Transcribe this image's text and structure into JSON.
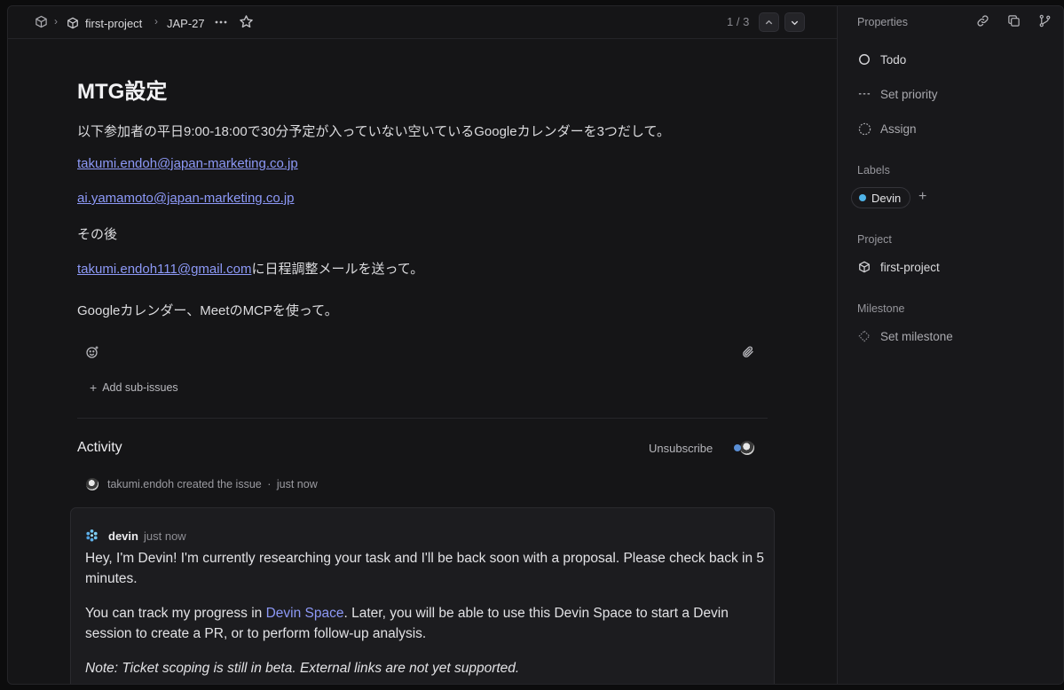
{
  "header": {
    "breadcrumbs": [
      "first-project",
      "JAP-27"
    ],
    "pager": "1 / 3"
  },
  "issue": {
    "title": "MTG設定",
    "paragraph1": "以下参加者の平日9:00-18:00で30分予定が入っていない空いているGoogleカレンダーを3つだして。",
    "email1": "takumi.endoh@japan-marketing.co.jp",
    "email2": "ai.yamamoto@japan-marketing.co.jp",
    "then": "その後",
    "email3": "takumi.endoh111@gmail.com",
    "email3_suffix": "に日程調整メールを送って。",
    "paragraph_last": "Googleカレンダー、MeetのMCPを使って。",
    "add_sub_issues": "Add sub-issues"
  },
  "activity": {
    "heading": "Activity",
    "unsubscribe": "Unsubscribe",
    "created_text": "takumi.endoh created the issue",
    "created_sep": "·",
    "created_time": "just now",
    "comment": {
      "author": "devin",
      "time": "just now",
      "line1": "Hey, I'm Devin! I'm currently researching your task and I'll be back soon with a proposal. Please check back in 5 minutes.",
      "line2_before": "You can track my progress in ",
      "line2_link": "Devin Space",
      "line2_after": ". Later, you will be able to use this Devin Space to start a Devin session to create a PR, or to perform follow-up analysis.",
      "line3": "Note: Ticket scoping is still in beta. External links are not yet supported."
    }
  },
  "sidebar": {
    "heading": "Properties",
    "status": "Todo",
    "priority": "Set priority",
    "assign": "Assign",
    "labels_heading": "Labels",
    "label_chip": "Devin",
    "label_color": "#4fb3e8",
    "project_heading": "Project",
    "project": "first-project",
    "milestone_heading": "Milestone",
    "milestone": "Set milestone"
  },
  "colors": {
    "accent_link": "#8d99f7",
    "background": "#151517"
  }
}
